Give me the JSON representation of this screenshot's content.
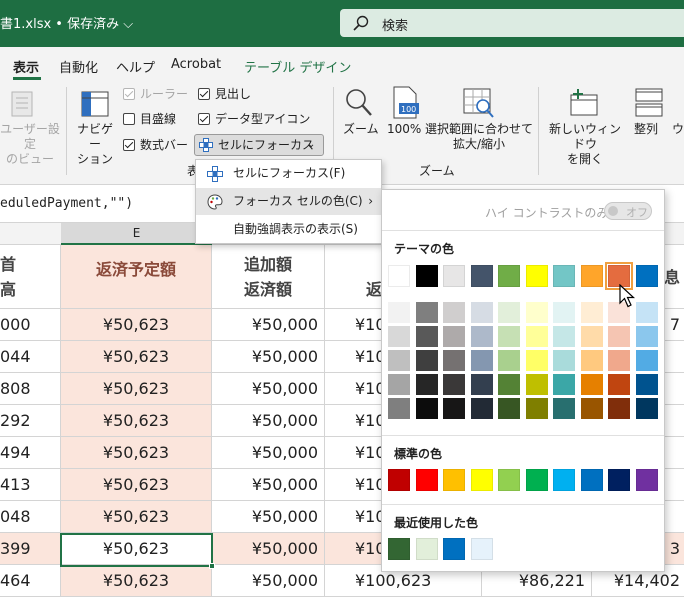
{
  "titlebar": {
    "doc_title": "書1.xlsx • 保存済み",
    "search_placeholder": "検索"
  },
  "tabs": [
    {
      "label": "表示",
      "active": true
    },
    {
      "label": "自動化"
    },
    {
      "label": "ヘルプ"
    },
    {
      "label": "Acrobat"
    },
    {
      "label": "テーブル デザイン",
      "color": "#217346"
    }
  ],
  "ribbon": {
    "user_view": "ユーザー設定\nのビュー",
    "navigation": "ナビゲー\nション",
    "ruler": "ルーラー",
    "gridlines": "目盛線",
    "formula_bar": "数式バー",
    "headings": "見出し",
    "data_type_icons": "データ型アイコン",
    "cell_focus": "セルにフォーカス",
    "display_group": "表",
    "zoom": "ズーム",
    "zoom100": "100%",
    "zoom_selection": "選択範囲に合わせて\n拡大/縮小",
    "zoom_group": "ズーム",
    "new_window": "新しいウィンドウ\nを開く",
    "arrange": "整列",
    "more": "ウ"
  },
  "formula": "eduledPayment,\"\")",
  "column_header": "E",
  "table": {
    "headers": {
      "d": "首\n高",
      "e": "返済予定額",
      "f": "追加額\n返済額",
      "g": "返",
      "h": "",
      "i": "息"
    },
    "rows": [
      {
        "d": "000",
        "e": "¥50,623",
        "f": "¥50,000",
        "g": "¥10",
        "i": "7",
        "hl": false
      },
      {
        "d": "044",
        "e": "¥50,623",
        "f": "¥50,000",
        "g": "¥10",
        "i": "",
        "hl": false
      },
      {
        "d": "808",
        "e": "¥50,623",
        "f": "¥50,000",
        "g": "¥10",
        "i": "",
        "hl": false
      },
      {
        "d": "292",
        "e": "¥50,623",
        "f": "¥50,000",
        "g": "¥10",
        "i": "",
        "hl": false
      },
      {
        "d": "494",
        "e": "¥50,623",
        "f": "¥50,000",
        "g": "¥10",
        "i": "",
        "hl": false
      },
      {
        "d": "413",
        "e": "¥50,623",
        "f": "¥50,000",
        "g": "¥10",
        "i": "",
        "hl": false
      },
      {
        "d": "048",
        "e": "¥50,623",
        "f": "¥50,000",
        "g": "¥10",
        "i": "",
        "hl": false
      },
      {
        "d": "399",
        "e": "¥50,623",
        "f": "¥50,000",
        "g": "¥10",
        "i": "3",
        "hl": true
      },
      {
        "d": "464",
        "e": "¥50,623",
        "f": "¥50,000",
        "g": "¥100,623",
        "h": "¥86,221",
        "i": "¥14,402",
        "hl": false
      }
    ]
  },
  "menu": {
    "items": [
      "セルにフォーカス(F)",
      "フォーカス セルの色(C)",
      "自動強調表示の表示(S)"
    ]
  },
  "palette": {
    "high_contrast": "ハイ コントラストのみ(H)",
    "toggle": "オフ",
    "theme_label": "テーマの色",
    "standard_label": "標準の色",
    "recent_label": "最近使用した色",
    "theme_top": [
      "#ffffff",
      "#000000",
      "#e7e6e6",
      "#44546a",
      "#70ad47",
      "#ffff00",
      "#73c6c6",
      "#ffa52a",
      "#e46c3f",
      "#0070c0"
    ],
    "theme_shades": [
      [
        "#f2f2f2",
        "#7f7f7f",
        "#d0cece",
        "#d6dce4",
        "#e2efda",
        "#ffffcc",
        "#e2f3f3",
        "#ffedd4",
        "#fae2d9",
        "#c5e3f6"
      ],
      [
        "#d8d8d8",
        "#595959",
        "#aeaaaa",
        "#adb9ca",
        "#c6e0b4",
        "#ffff99",
        "#c5e7e7",
        "#ffdba9",
        "#f5c5b2",
        "#8bc7ed"
      ],
      [
        "#bfbfbf",
        "#3f3f3f",
        "#757171",
        "#8497b0",
        "#a9d08e",
        "#ffff66",
        "#a9dbdb",
        "#ffc97f",
        "#f0a88c",
        "#52abe4"
      ],
      [
        "#a5a5a5",
        "#262626",
        "#3a3838",
        "#333f4f",
        "#548235",
        "#bfbf00",
        "#3ba7a7",
        "#e68000",
        "#c04510",
        "#00538f"
      ],
      [
        "#7f7f7f",
        "#0c0c0c",
        "#171616",
        "#222a35",
        "#375623",
        "#7f7f00",
        "#286f6f",
        "#995500",
        "#802e0b",
        "#00375f"
      ]
    ],
    "standard": [
      "#c00000",
      "#ff0000",
      "#ffc000",
      "#ffff00",
      "#92d050",
      "#00b050",
      "#00b0f0",
      "#0070c0",
      "#002060",
      "#7030a0"
    ],
    "recent": [
      "#336633",
      "#e2efda",
      "#0070c0",
      "#e6f2fb"
    ]
  }
}
